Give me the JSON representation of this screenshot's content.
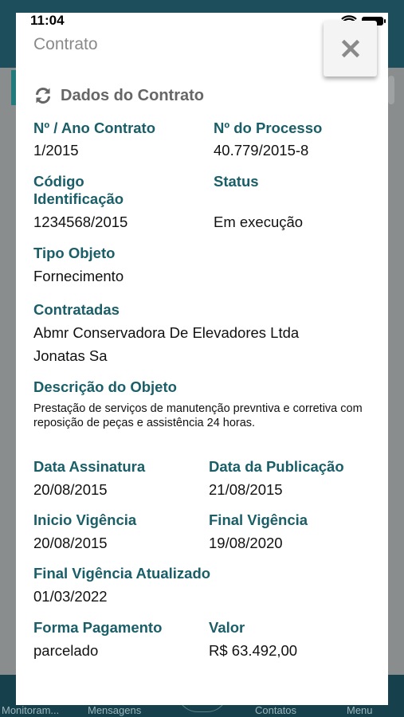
{
  "status_bar": {
    "time": "11:04"
  },
  "modal": {
    "title": "Contrato",
    "close_icon": "close-icon",
    "section_title": "Dados do Contrato",
    "section_icon": "refresh-icon"
  },
  "fields": {
    "numero_ano": {
      "label": "Nº / Ano Contrato",
      "value": "1/2015"
    },
    "numero_processo": {
      "label": "Nº do Processo",
      "value": "40.779/2015-8"
    },
    "codigo": {
      "label_line1": "Código",
      "label_line2": "Identificação",
      "value": "1234568/2015"
    },
    "status": {
      "label": "Status",
      "value": "Em execução"
    },
    "tipo_objeto": {
      "label": "Tipo Objeto",
      "value": "Fornecimento"
    },
    "contratadas": {
      "label": "Contratadas",
      "values": [
        "Abmr Conservadora De Elevadores Ltda",
        "Jonatas Sa"
      ]
    },
    "descricao": {
      "label": "Descrição do Objeto",
      "value": "Prestação de serviços de manutenção prevntiva e corretiva com reposição de peças e assistência  24 horas."
    },
    "data_assinatura": {
      "label": "Data Assinatura",
      "value": "20/08/2015"
    },
    "data_publicacao": {
      "label": "Data da Publicação",
      "value": "21/08/2015"
    },
    "inicio_vigencia": {
      "label": "Inicio Vigência",
      "value": "20/08/2015"
    },
    "final_vigencia": {
      "label": "Final Vigência",
      "value": "19/08/2020"
    },
    "final_vigencia_atualizado": {
      "label": "Final Vigência Atualizado",
      "value": "01/03/2022"
    },
    "forma_pagamento": {
      "label": "Forma Pagamento",
      "value": "parcelado"
    },
    "valor": {
      "label": "Valor",
      "value": "R$ 63.492,00"
    }
  },
  "tab_bar": {
    "items": [
      "Monitoram...",
      "Mensagens",
      "Contatos",
      "Menu"
    ]
  },
  "colors": {
    "accent": "#1a5e68",
    "header": "#1d4e5b",
    "overlay": "#8a8d8e"
  }
}
